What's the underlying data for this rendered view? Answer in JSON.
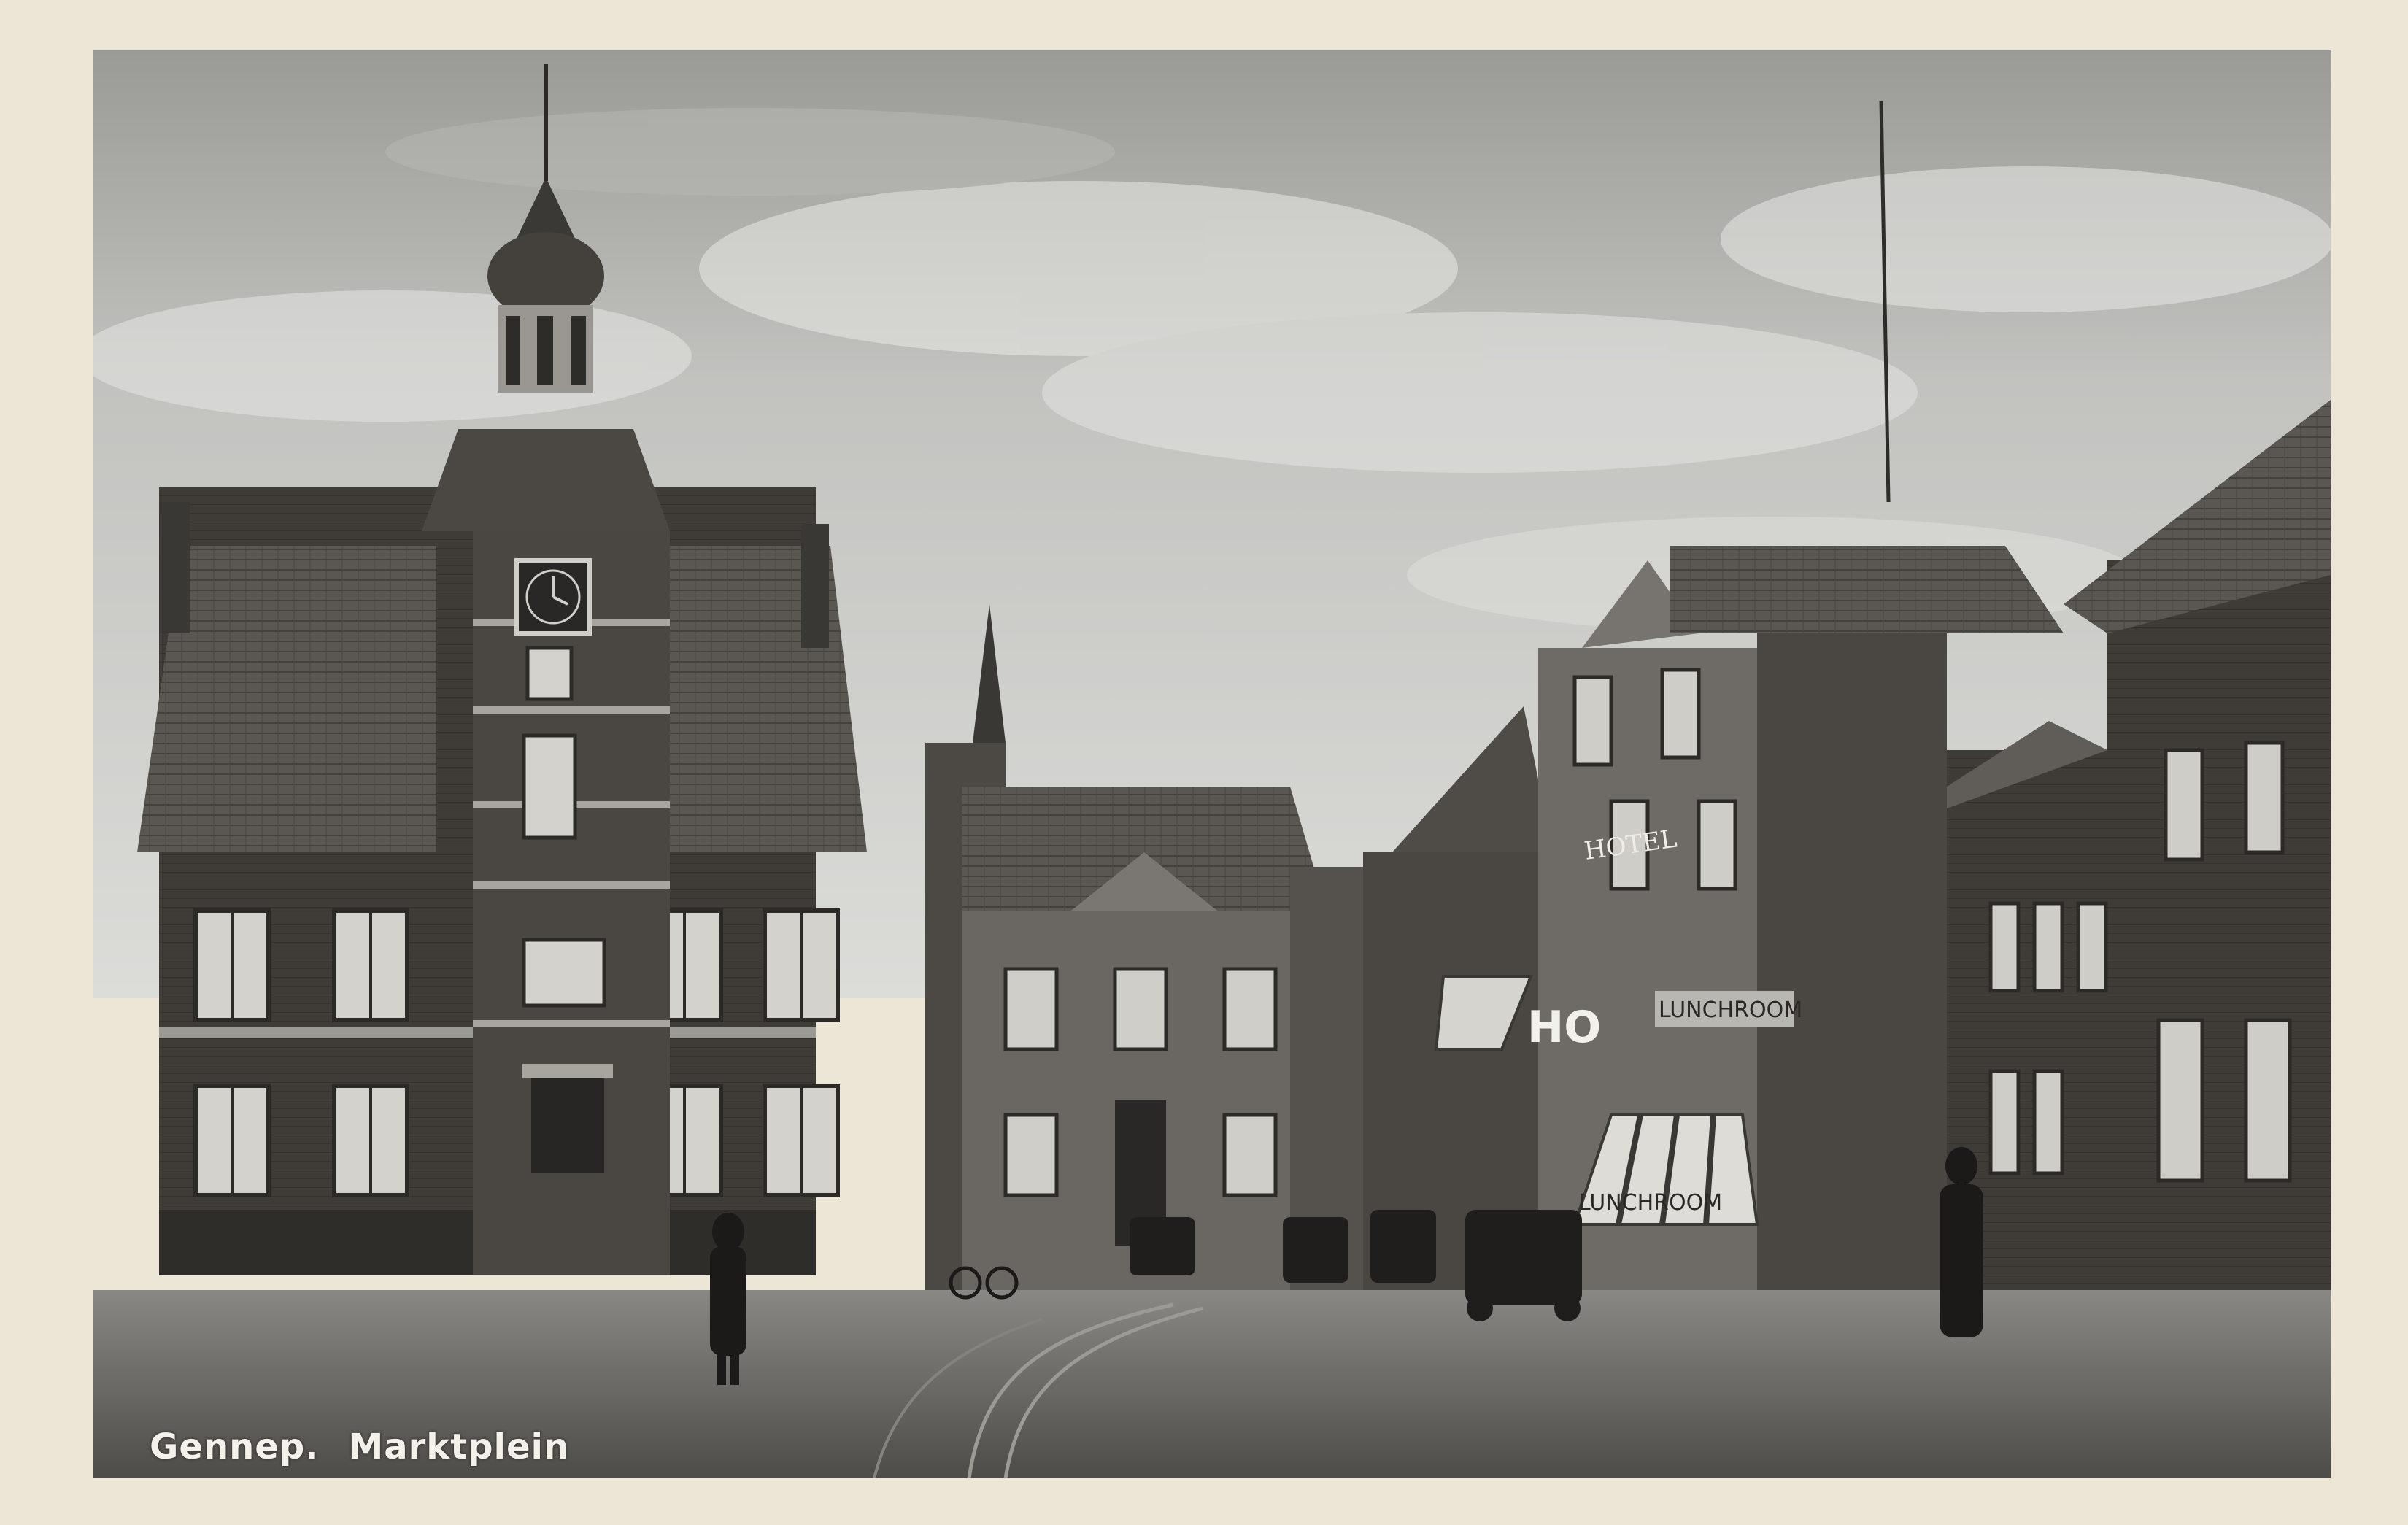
{
  "caption": {
    "place": "Gennep.",
    "square": "Marktplein"
  },
  "signs": {
    "hotel": "HOTEL",
    "ho": "HO",
    "lunchroom_upper": "LUNCHROOM",
    "lunchroom_awning": "LUNCHROOM"
  },
  "colors": {
    "card": "#ece6d6",
    "sky_light": "#d9d9d6",
    "sky_dark": "#8e8e8a",
    "brick_dark": "#3c3a36",
    "roof": "#56534e",
    "street": "#5e5c58"
  }
}
